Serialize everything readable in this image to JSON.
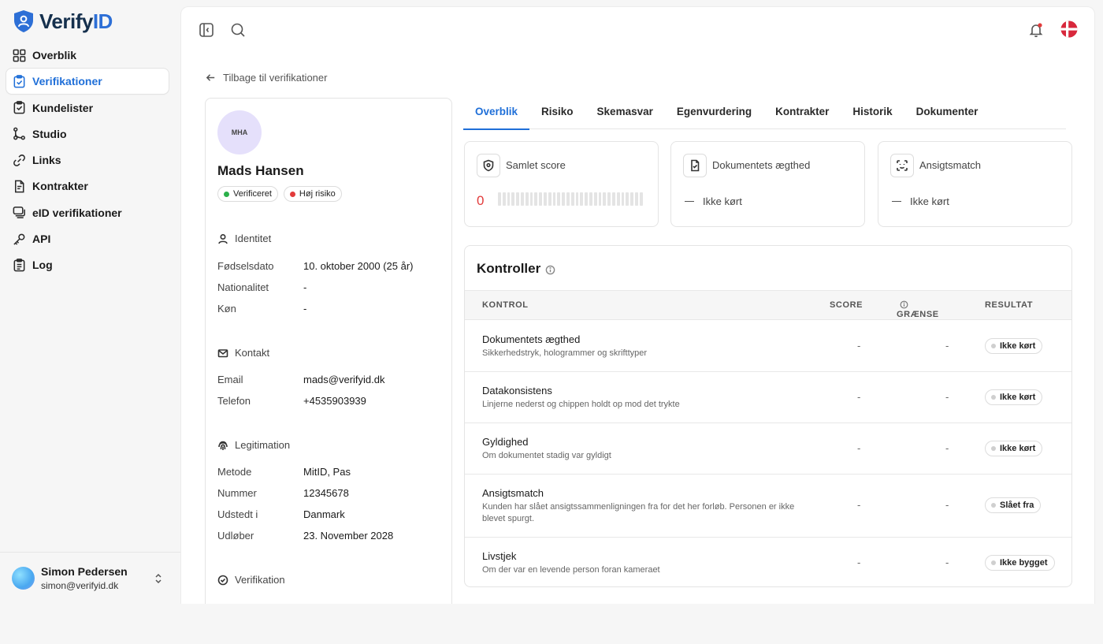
{
  "brand": {
    "name_part1": "Verify",
    "name_part2": "ID",
    "color": "#2d6fd6"
  },
  "sidebar": {
    "items": [
      {
        "label": "Overblik",
        "icon": "grid-icon"
      },
      {
        "label": "Verifikationer",
        "icon": "clipboard-check-icon",
        "active": true
      },
      {
        "label": "Kundelister",
        "icon": "clipboard-list-icon"
      },
      {
        "label": "Studio",
        "icon": "workflow-icon"
      },
      {
        "label": "Links",
        "icon": "link-icon"
      },
      {
        "label": "Kontrakter",
        "icon": "document-icon"
      },
      {
        "label": "eID verifikationer",
        "icon": "stack-icon"
      },
      {
        "label": "API",
        "icon": "key-icon"
      },
      {
        "label": "Log",
        "icon": "log-icon"
      }
    ],
    "user": {
      "name": "Simon Pedersen",
      "email": "simon@verifyid.dk"
    }
  },
  "back_link": "Tilbage til verifikationer",
  "profile": {
    "initials": "MHA",
    "name": "Mads Hansen",
    "badges": [
      {
        "label": "Verificeret",
        "color": "#2bb04a"
      },
      {
        "label": "Høj risiko",
        "color": "#e23b3b"
      }
    ],
    "sections": {
      "identitet": {
        "title": "Identitet",
        "rows": [
          {
            "k": "Fødselsdato",
            "v": "10. oktober 2000 (25 år)"
          },
          {
            "k": "Nationalitet",
            "v": "-"
          },
          {
            "k": "Køn",
            "v": "-"
          }
        ]
      },
      "kontakt": {
        "title": "Kontakt",
        "rows": [
          {
            "k": "Email",
            "v": "mads@verifyid.dk"
          },
          {
            "k": "Telefon",
            "v": "+4535903939"
          }
        ]
      },
      "legitimation": {
        "title": "Legitimation",
        "rows": [
          {
            "k": "Metode",
            "v": "MitID, Pas"
          },
          {
            "k": "Nummer",
            "v": "12345678"
          },
          {
            "k": "Udstedt i",
            "v": "Danmark"
          },
          {
            "k": "Udløber",
            "v": "23. November 2028"
          }
        ]
      },
      "verifikation": {
        "title": "Verifikation"
      }
    }
  },
  "tabs": [
    "Overblik",
    "Risiko",
    "Skemasvar",
    "Egenvurdering",
    "Kontrakter",
    "Historik",
    "Dokumenter"
  ],
  "cards": {
    "score": {
      "title": "Samlet score",
      "value": "0",
      "meter_fill": 0
    },
    "document": {
      "title": "Dokumentets ægthed",
      "status": "Ikke kørt"
    },
    "face": {
      "title": "Ansigtsmatch",
      "status": "Ikke kørt"
    }
  },
  "controls": {
    "title": "Kontroller",
    "headers": {
      "control": "KONTROL",
      "score": "SCORE",
      "limit": "GRÆNSE",
      "result": "RESULTAT"
    },
    "rows": [
      {
        "name": "Dokumentets ægthed",
        "desc": "Sikkerhedstryk, hologrammer og skrifttyper",
        "score": "-",
        "limit": "-",
        "result": "Ikke kørt"
      },
      {
        "name": "Datakonsistens",
        "desc": "Linjerne nederst og chippen holdt op mod det trykte",
        "score": "-",
        "limit": "-",
        "result": "Ikke kørt"
      },
      {
        "name": "Gyldighed",
        "desc": "Om dokumentet stadig var gyldigt",
        "score": "-",
        "limit": "-",
        "result": "Ikke kørt"
      },
      {
        "name": "Ansigtsmatch",
        "desc": "Kunden har slået ansigtssammenligningen fra for det her forløb. Personen er ikke blevet spurgt.",
        "score": "-",
        "limit": "-",
        "result": "Slået fra"
      },
      {
        "name": "Livstjek",
        "desc": "Om der var en levende person foran kameraet",
        "score": "-",
        "limit": "-",
        "result": "Ikke bygget"
      }
    ]
  }
}
